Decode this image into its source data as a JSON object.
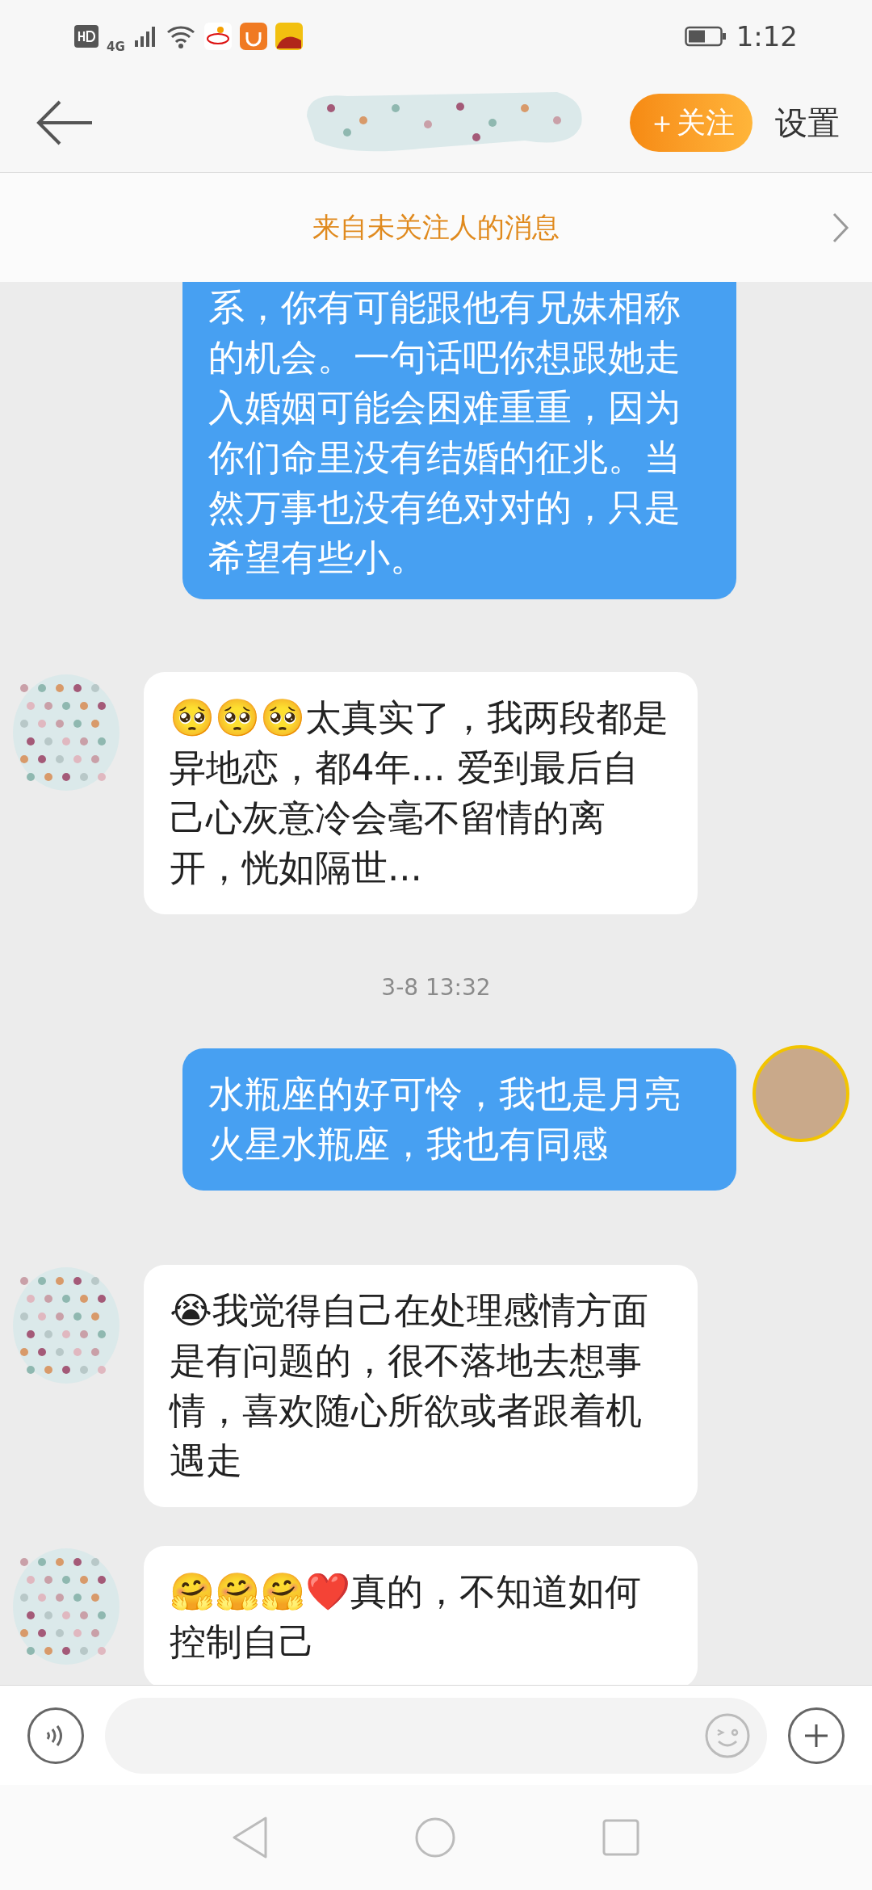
{
  "status_bar": {
    "network": "4G",
    "time": "1:12"
  },
  "header": {
    "follow_button": "＋关注",
    "settings": "设置"
  },
  "notice": {
    "text": "来自未关注人的消息"
  },
  "messages": [
    {
      "kind": "sent",
      "avatar": false,
      "text": "系，你有可能跟他有兄妹相称的机会。一句话吧你想跟她走入婚姻可能会困难重重，因为你们命里没有结婚的征兆。当然万事也没有绝对对的，只是希望有些小。"
    },
    {
      "kind": "received",
      "avatar": true,
      "text": "🥺🥺🥺太真实了，我两段都是异地恋，都4年... 爱到最后自己心灰意冷会毫不留情的离开，恍如隔世..."
    },
    {
      "kind": "time",
      "text": "3-8 13:32"
    },
    {
      "kind": "sent",
      "avatar": true,
      "text": "水瓶座的好可怜，我也是月亮火星水瓶座，我也有同感"
    },
    {
      "kind": "received",
      "avatar": true,
      "text": "😭我觉得自己在处理感情方面是有问题的，很不落地去想事情，喜欢随心所欲或者跟着机遇走"
    },
    {
      "kind": "received",
      "avatar": true,
      "text": "🤗🤗🤗❤️真的，不知道如何控制自己"
    }
  ]
}
